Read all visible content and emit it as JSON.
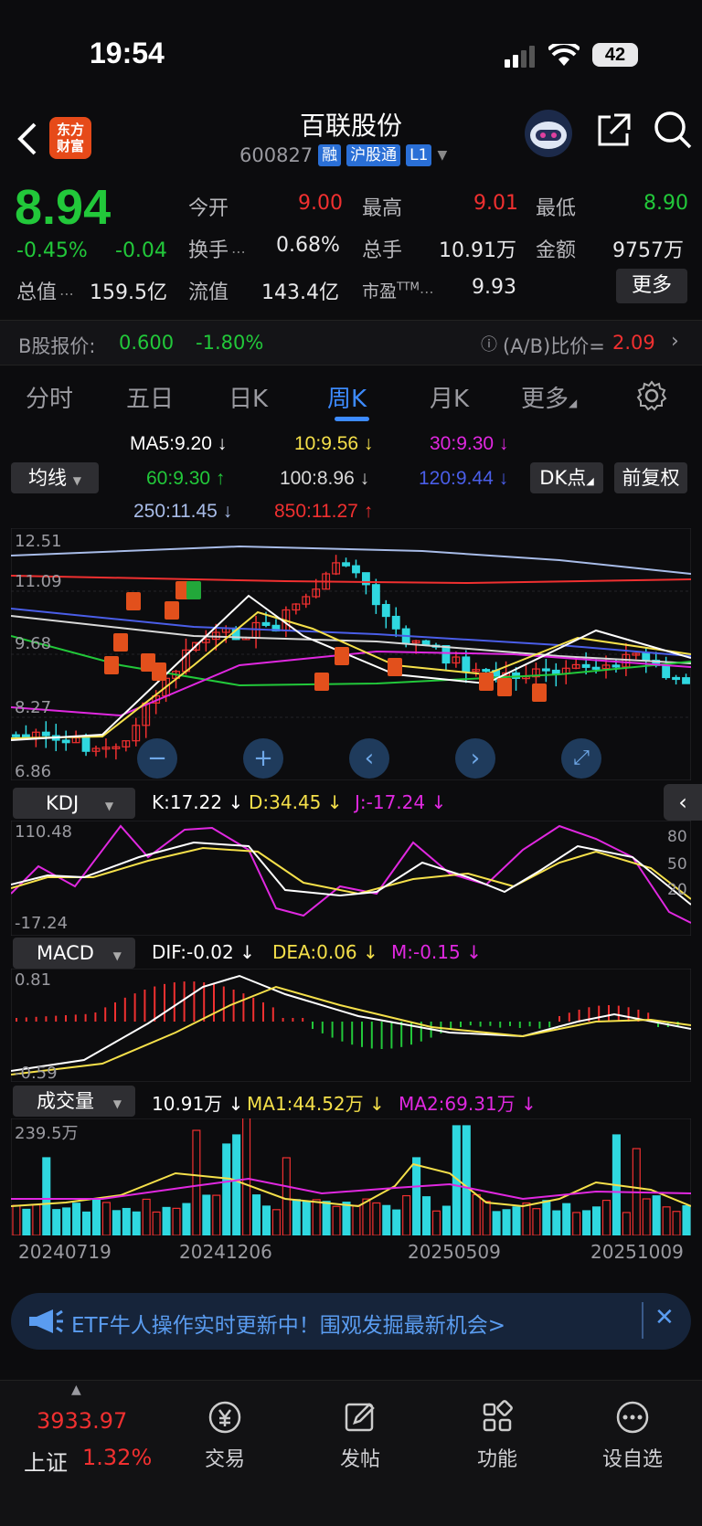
{
  "status_bar": {
    "time": "19:54",
    "battery": "42"
  },
  "header": {
    "app_logo": "东方\n财富",
    "title": "百联股份",
    "code": "600827",
    "tags": [
      "融",
      "沪股通",
      "L1"
    ]
  },
  "quote": {
    "price": "8.94",
    "change_pct": "-0.45%",
    "change": "-0.04",
    "open_label": "今开",
    "open": "9.00",
    "high_label": "最高",
    "high": "9.01",
    "low_label": "最低",
    "low": "8.90",
    "turnover_label": "换手",
    "turnover": "0.68%",
    "volume_label": "总手",
    "volume": "10.91万",
    "amount_label": "金额",
    "amount": "9757万",
    "mktcap_label": "总值",
    "mktcap": "159.5亿",
    "float_label": "流值",
    "float_cap": "143.4亿",
    "pe_label": "市盈",
    "pe_sup": "TTM",
    "pe": "9.93",
    "more_button": "更多"
  },
  "b_share": {
    "label": "B股报价:",
    "price": "0.600",
    "change": "-1.80%",
    "ratio_label": "(A/B)比价=",
    "ratio": "2.09"
  },
  "tabs": [
    "分时",
    "五日",
    "日K",
    "周K",
    "月K",
    "更多"
  ],
  "active_tab": "周K",
  "ma_panel": {
    "selector": "均线",
    "legend": [
      {
        "text": "MA5:9.20",
        "color": "#ffffff"
      },
      {
        "text": "10:9.56",
        "color": "#f5e04a"
      },
      {
        "text": "30:9.30",
        "color": "#e028e0"
      },
      {
        "text": "60:9.30",
        "color": "#22c83a"
      },
      {
        "text": "100:8.96",
        "color": "#d8d8d8"
      },
      {
        "text": "120:9.44",
        "color": "#4a5ee8"
      },
      {
        "text": "250:11.45",
        "color": "#a8bce8"
      },
      {
        "text": "850:11.27",
        "color": "#f03030"
      }
    ],
    "dk_button": "DK点",
    "adjust_button": "前复权",
    "y_labels": [
      "12.51",
      "11.09",
      "9.68",
      "8.27",
      "6.86"
    ]
  },
  "kdj": {
    "selector": "KDJ",
    "k": "K:17.22",
    "d": "D:34.45",
    "j": "J:-17.24",
    "top": "110.48",
    "bottom": "-17.24",
    "right_labels": [
      "80",
      "50",
      "20"
    ]
  },
  "macd": {
    "selector": "MACD",
    "dif": "DIF:-0.02",
    "dea": "DEA:0.06",
    "m": "M:-0.15",
    "top": "0.81",
    "bottom": "-0.59"
  },
  "vol": {
    "selector": "成交量",
    "v": "10.91万",
    "ma1": "MA1:44.52万",
    "ma2": "MA2:69.31万",
    "top": "239.5万"
  },
  "dates": [
    "20240719",
    "20241206",
    "20250509",
    "20251009"
  ],
  "banner": {
    "text": "ETF牛人操作实时更新中！围观发掘最新机会>"
  },
  "bottom_nav": {
    "index_value": "3933.97",
    "index_name": "上证",
    "index_change": "1.32%",
    "items": [
      "交易",
      "发帖",
      "功能",
      "设自选"
    ]
  }
}
